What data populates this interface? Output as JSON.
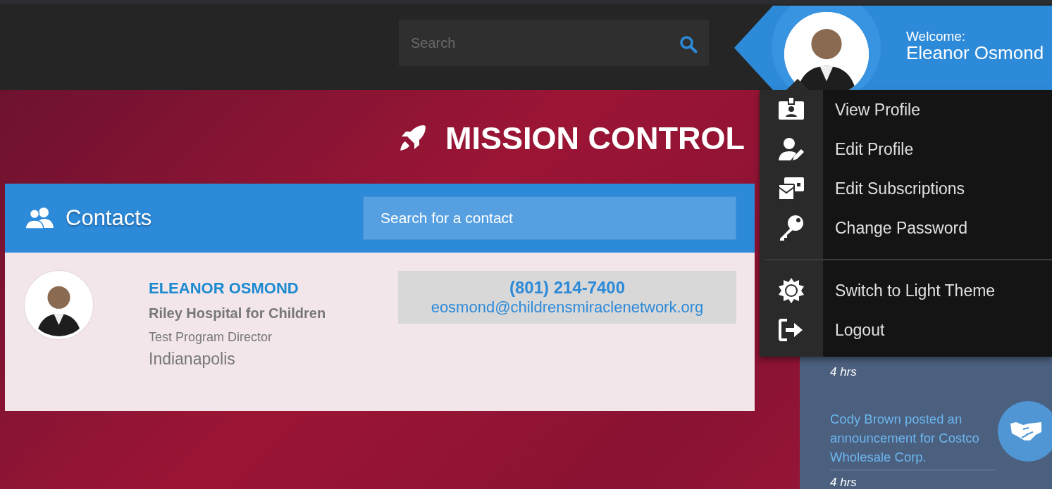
{
  "header": {
    "search": {
      "placeholder": "Search"
    },
    "welcome": {
      "label": "Welcome:",
      "name": "Eleanor Osmond"
    }
  },
  "user_menu": {
    "groups": [
      [
        {
          "label": "View Profile"
        },
        {
          "label": "Edit Profile"
        },
        {
          "label": "Edit Subscriptions"
        },
        {
          "label": "Change Password"
        }
      ],
      [
        {
          "label": "Switch to Light Theme"
        },
        {
          "label": "Logout"
        }
      ]
    ]
  },
  "page_title": "MISSION CONTROL",
  "contacts": {
    "title": "Contacts",
    "search": {
      "placeholder": "Search for a contact"
    },
    "items": [
      {
        "name": "ELEANOR OSMOND",
        "organization": "Riley Hospital for Children",
        "role": "Test Program Director",
        "city": "Indianapolis",
        "phone": "(801) 214-7400",
        "email": "eosmond@childrensmiraclenetwork.org"
      }
    ]
  },
  "feed": {
    "items": [
      {
        "time": "4 hrs"
      },
      {
        "text": "Cody Brown posted an announcement for Costco Wholesale Corp.",
        "time": "4 hrs"
      }
    ]
  }
}
